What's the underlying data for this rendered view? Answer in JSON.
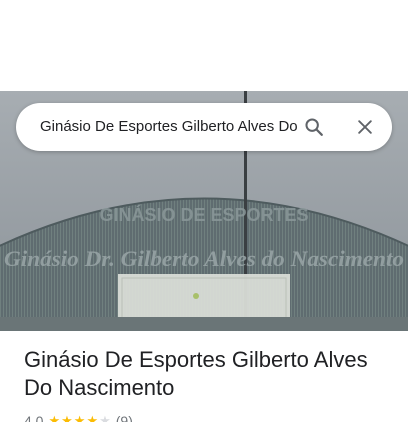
{
  "search": {
    "value": "Ginásio De Esportes Gilberto Alves Do Nascimento",
    "search_icon": "search-icon",
    "close_icon": "close-icon"
  },
  "photo": {
    "sign_top": "GINÁSIO DE ESPORTES",
    "sign_main": "Ginásio Dr. Gilberto Alves do Nascimento"
  },
  "place": {
    "name": "Ginásio De Esportes Gilberto Alves Do Nascimento",
    "rating": "4.0",
    "rating_value": 4,
    "rating_max": 5,
    "review_count": "(9)"
  },
  "colors": {
    "star_filled": "#fbbc04",
    "star_empty": "#dadce0",
    "icon": "#5f6368",
    "text": "#202124"
  }
}
